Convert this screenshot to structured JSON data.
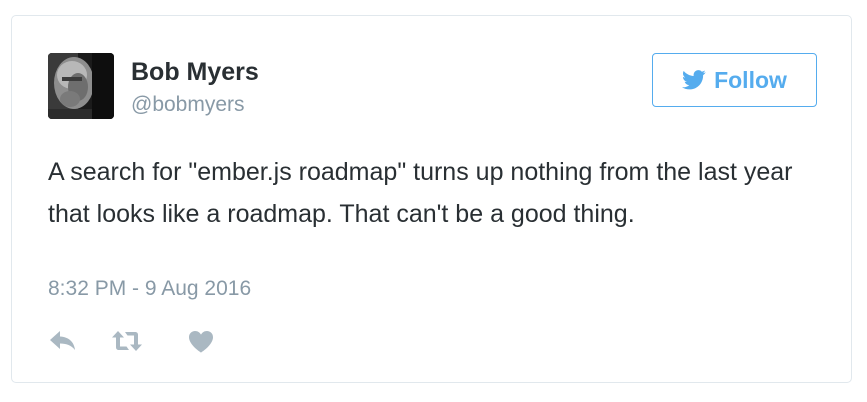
{
  "tweet": {
    "author": {
      "name": "Bob Myers",
      "handle": "@bobmyers"
    },
    "follow_button": {
      "label": "Follow",
      "icon": "twitter-bird-icon"
    },
    "text": "A search for \"ember.js roadmap\" turns up nothing from the last year that looks like a roadmap. That can't be a good thing.",
    "timestamp": "8:32 PM - 9 Aug 2016",
    "actions": {
      "reply_icon": "reply-icon",
      "retweet_icon": "retweet-icon",
      "like_icon": "heart-icon"
    }
  },
  "colors": {
    "accent": "#55acee",
    "text": "#292f33",
    "muted": "#8899a6",
    "icon": "#aab8c2",
    "border": "#e1e8ed"
  }
}
